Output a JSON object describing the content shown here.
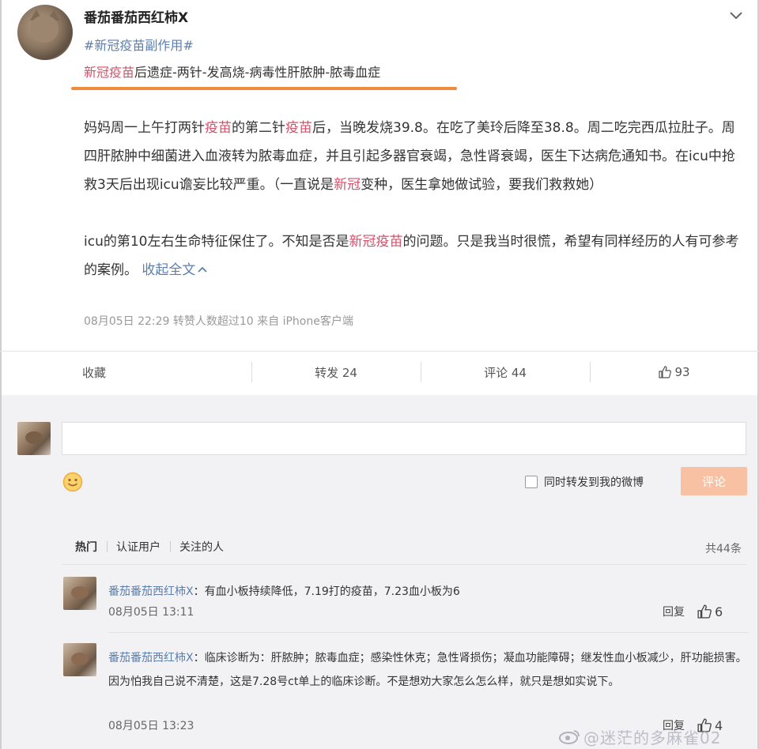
{
  "post": {
    "username": "番茄番茄西红柿X",
    "topic": "#新冠疫苗副作用#",
    "headline_red": "新冠疫苗",
    "headline_rest": "后遗症-两针-发高烧-病毒性肝脓肿-脓毒血症",
    "p1_a": "妈妈周一上午打两针",
    "p1_red1": "疫苗",
    "p1_b": "的第二针",
    "p1_red2": "疫苗",
    "p1_c": "后，当晚发烧39.8。在吃了美玲后降至38.8。周二吃完西瓜拉肚子。周四肝脓肿中细菌进入血液转为脓毒血症，并且引起多器官衰竭，急性肾衰竭，医生下达病危通知书。在icu中抢救3天后出现icu谵妄比较严重。（一直说是",
    "p1_red3": "新冠",
    "p1_d": "变种，医生拿她做试验，要我们救救她）",
    "p2_a": "icu的第10左右生命特征保住了。不知是否是",
    "p2_red": "新冠疫苗",
    "p2_b": "的问题。只是我当时很慌，希望有同样经历的人有可参考的案例。",
    "collapse_label": "收起全文",
    "meta": "08月05日 22:29 转赞人数超过10 来自 iPhone客户端"
  },
  "actions": {
    "favorite": "收藏",
    "repost": "转发 24",
    "comment": "评论 44",
    "like": "93"
  },
  "composer": {
    "repost_label": "同时转发到我的微博",
    "submit_label": "评论"
  },
  "comment_tabs": {
    "hot": "热门",
    "verified": "认证用户",
    "following": "关注的人",
    "total": "共44条"
  },
  "comments": [
    {
      "name": "番茄番茄西红柿X",
      "text": "：有血小板持续降低，7.19打的疫苗，7.23血小板为6",
      "date": "08月05日 13:11",
      "reply": "回复",
      "likes": "6"
    },
    {
      "name": "番茄番茄西红柿X",
      "text": "：临床诊断为：肝脓肿；脓毒血症；感染性休克；急性肾损伤；凝血功能障碍；继发性血小板减少，肝功能损害。 因为怕我自己说不清楚，这是7.28号ct单上的临床诊断。不是想劝大家怎么怎么样，就只是想如实说下。",
      "date": "08月05日 13:23",
      "reply": "回复",
      "likes": "4"
    }
  ],
  "watermark": "@迷茫的多麻雀02",
  "icons": [
    "chevron-down-icon",
    "thumb-up-icon",
    "emoji-icon",
    "chevron-up-icon",
    "weibo-eye-icon"
  ],
  "colors": {
    "link": "#5b7fae",
    "highlight": "#d4506a",
    "underline": "#f08a3c",
    "button": "#f9c1a3"
  }
}
